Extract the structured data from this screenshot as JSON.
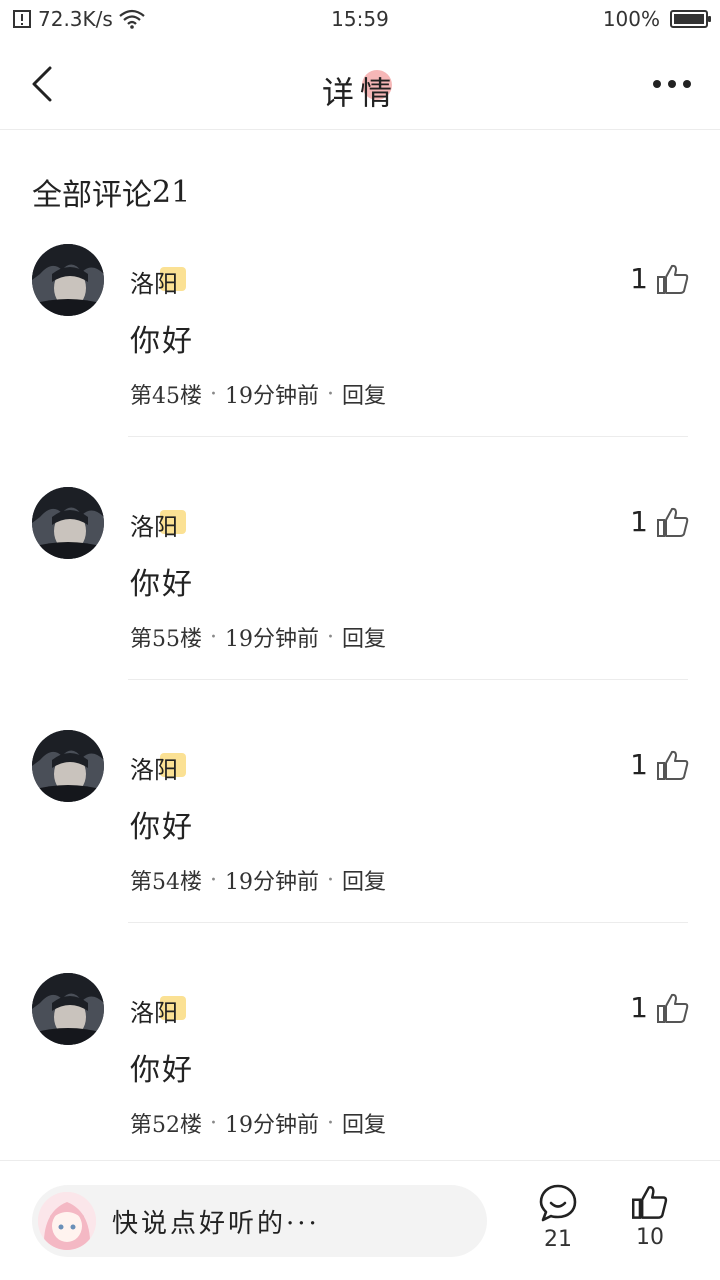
{
  "status_bar": {
    "network_speed": "72.3K/s",
    "time": "15:59",
    "battery": "100%",
    "battery_level": 1.0
  },
  "header": {
    "title": "详情"
  },
  "section": {
    "label_part1": "全部",
    "label_part2": "评论",
    "count": "21"
  },
  "comments": [
    {
      "username": "洛阳",
      "text": "你好",
      "floor": "第45楼",
      "time": "19分钟前",
      "reply": "回复",
      "likes": "1"
    },
    {
      "username": "洛阳",
      "text": "你好",
      "floor": "第55楼",
      "time": "19分钟前",
      "reply": "回复",
      "likes": "1"
    },
    {
      "username": "洛阳",
      "text": "你好",
      "floor": "第54楼",
      "time": "19分钟前",
      "reply": "回复",
      "likes": "1"
    },
    {
      "username": "洛阳",
      "text": "你好",
      "floor": "第52楼",
      "time": "19分钟前",
      "reply": "回复",
      "likes": "1"
    }
  ],
  "bottom_bar": {
    "placeholder": "快说点好听的···",
    "comment_count": "21",
    "like_count": "10"
  },
  "colors": {
    "highlight_yellow": "#f8c83c",
    "highlight_green": "#78dc5a",
    "title_mark": "#ec6060"
  }
}
